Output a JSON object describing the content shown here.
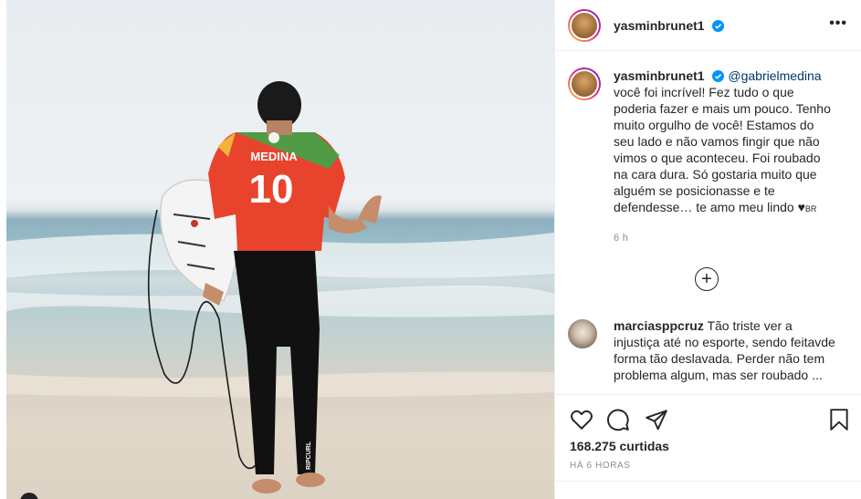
{
  "post": {
    "username": "yasminbrunet1",
    "more_label": "•••",
    "caption": {
      "username": "yasminbrunet1",
      "mention": "@gabrielmedina",
      "text": "você foi incrível! Fez tudo o que poderia fazer e mais um pouco. Tenho muito orgulho de você! Estamos do seu lado e não vamos fingir que não vimos o que aconteceu. Foi roubado na cara dura. Só gostaria muito que alguém se posicionasse e te defendesse… te amo meu lindo",
      "heart": "♥",
      "flag_text": "BR",
      "time": "6 h"
    },
    "load_more_label": "+",
    "comment": {
      "username": "marciasppcruz",
      "text": "Tão triste ver a injustiça até no esporte, sendo feitavde forma tão deslavada. Perder não tem problema algum, mas ser roubado ..."
    },
    "likes": "168.275 curtidas",
    "posted": "HÁ 6 HORAS",
    "jersey": {
      "name": "MEDINA",
      "number": "10"
    },
    "brand": "RIPCURL",
    "colors": {
      "verified": "#0095f6",
      "link": "#00376b",
      "jersey": "#e8442d"
    },
    "icons": [
      "heart-icon",
      "comment-icon",
      "share-icon",
      "bookmark-icon"
    ]
  }
}
